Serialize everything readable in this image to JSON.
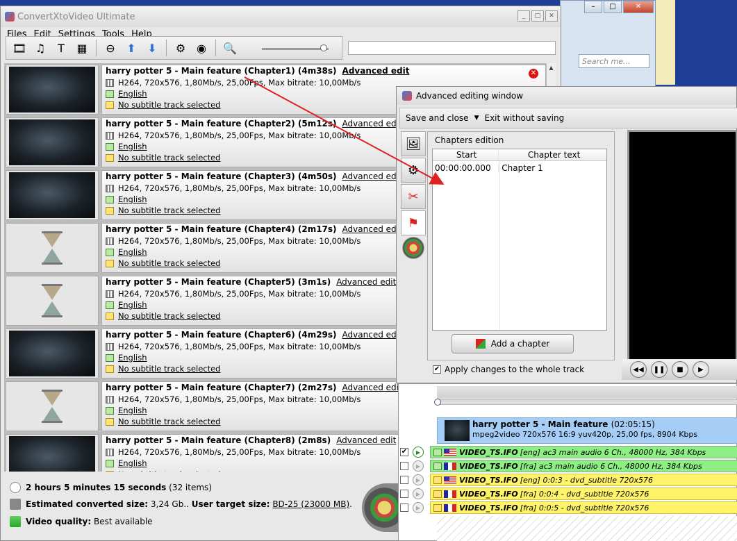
{
  "bg_window": {
    "search_placeholder": "Search me...",
    "min": "–",
    "max": "□",
    "close": "✕"
  },
  "main": {
    "title": "ConvertXtoVideo Ultimate",
    "menu": [
      "Files",
      "Edit",
      "Settings",
      "Tools",
      "Help"
    ],
    "toolbar_icons": [
      "add-video-icon",
      "add-audio-icon",
      "add-text-icon",
      "add-image-icon",
      "remove-icon",
      "move-up-icon",
      "move-down-icon",
      "settings-icon",
      "burn-icon",
      "preview-icon"
    ],
    "zoom_fraction": 0.9
  },
  "items": [
    {
      "title": "harry potter 5 - Main feature (Chapter1) (4m38s)",
      "adv": "Advanced edit",
      "video": "H264, 720x576, 1,80Mb/s, 25,00Fps, Max bitrate: 10,00Mb/s",
      "audio": "English",
      "subtitle": "No subtitle track selected",
      "thumb": "dark"
    },
    {
      "title": "harry potter 5 - Main feature (Chapter2) (5m12s)",
      "adv": "Advanced edit",
      "video": "H264, 720x576, 1,80Mb/s, 25,00Fps, Max bitrate: 10,00Mb/s",
      "audio": "English",
      "subtitle": "No subtitle track selected",
      "thumb": "dark"
    },
    {
      "title": "harry potter 5 - Main feature (Chapter3) (4m50s)",
      "adv": "Advanced edit",
      "video": "H264, 720x576, 1,80Mb/s, 25,00Fps, Max bitrate: 10,00Mb/s",
      "audio": "English",
      "subtitle": "No subtitle track selected",
      "thumb": "dark"
    },
    {
      "title": "harry potter 5 - Main feature (Chapter4) (2m17s)",
      "adv": "Advanced edit",
      "video": "H264, 720x576, 1,80Mb/s, 25,00Fps, Max bitrate: 10,00Mb/s",
      "audio": "English",
      "subtitle": "No subtitle track selected",
      "thumb": "hourglass"
    },
    {
      "title": "harry potter 5 - Main feature (Chapter5) (3m1s)",
      "adv": "Advanced edit",
      "video": "H264, 720x576, 1,80Mb/s, 25,00Fps, Max bitrate: 10,00Mb/s",
      "audio": "English",
      "subtitle": "No subtitle track selected",
      "thumb": "hourglass"
    },
    {
      "title": "harry potter 5 - Main feature (Chapter6) (4m29s)",
      "adv": "Advanced edit",
      "video": "H264, 720x576, 1,80Mb/s, 25,00Fps, Max bitrate: 10,00Mb/s",
      "audio": "English",
      "subtitle": "No subtitle track selected",
      "thumb": "dark"
    },
    {
      "title": "harry potter 5 - Main feature (Chapter7) (2m27s)",
      "adv": "Advanced edit",
      "video": "H264, 720x576, 1,80Mb/s, 25,00Fps, Max bitrate: 10,00Mb/s",
      "audio": "English",
      "subtitle": "No subtitle track selected",
      "thumb": "hourglass"
    },
    {
      "title": "harry potter 5 - Main feature (Chapter8) (2m8s)",
      "adv": "Advanced edit",
      "video": "H264, 720x576, 1,80Mb/s, 25,00Fps, Max bitrate: 10,00Mb/s",
      "audio": "English",
      "subtitle": "No subtitle track selected",
      "thumb": "dark"
    }
  ],
  "status": {
    "duration": "2 hours 5 minutes 15 seconds",
    "items_count": "(32 items)",
    "est_label": "Estimated converted size:",
    "est_value": "3,24 Gb..",
    "target_label": "User target size:",
    "target_value": "BD-25 (23000 MB)",
    "target_end": ".",
    "quality_label": "Video quality:",
    "quality_value": "Best available"
  },
  "adv": {
    "title": "Advanced editing window",
    "save": "Save and close",
    "dropdown": "▼",
    "exit": "Exit without saving",
    "group": "Chapters edition",
    "col_start": "Start",
    "col_text": "Chapter text",
    "rows": [
      {
        "start": "00:00:00.000",
        "text": "Chapter 1"
      }
    ],
    "add_btn": "Add a chapter",
    "apply": "Apply changes to the whole track",
    "apply_checked": true
  },
  "tracks": {
    "video_title": "harry potter 5 - Main feature",
    "video_duration": "(02:05:15)",
    "video_info": "mpeg2video 720x576 16:9 yuv420p, 25,00 fps, 8904 Kbps",
    "rows": [
      {
        "type": "audio",
        "checked": true,
        "active": true,
        "flag": "us",
        "file": "VIDEO_TS.IFO",
        "desc": "[eng] ac3 main audio 6 Ch., 48000 Hz, 384 Kbps"
      },
      {
        "type": "audio",
        "checked": false,
        "active": false,
        "flag": "fr",
        "file": "VIDEO_TS.IFO",
        "desc": "[fra] ac3 main audio 6 Ch., 48000 Hz, 384 Kbps"
      },
      {
        "type": "sub",
        "checked": false,
        "active": false,
        "flag": "us",
        "file": "VIDEO_TS.IFO",
        "desc": "[eng] 0:0:3 - dvd_subtitle 720x576"
      },
      {
        "type": "sub",
        "checked": false,
        "active": false,
        "flag": "fr",
        "file": "VIDEO_TS.IFO",
        "desc": "[fra] 0:0:4 - dvd_subtitle 720x576"
      },
      {
        "type": "sub",
        "checked": false,
        "active": false,
        "flag": "fr",
        "file": "VIDEO_TS.IFO",
        "desc": "[fra] 0:0:5 - dvd_subtitle 720x576"
      }
    ]
  },
  "colors": {
    "video_track": "#a5cdf6",
    "audio_track": "#8ef084",
    "sub_track": "#fff36a",
    "arrow": "#e02020"
  }
}
